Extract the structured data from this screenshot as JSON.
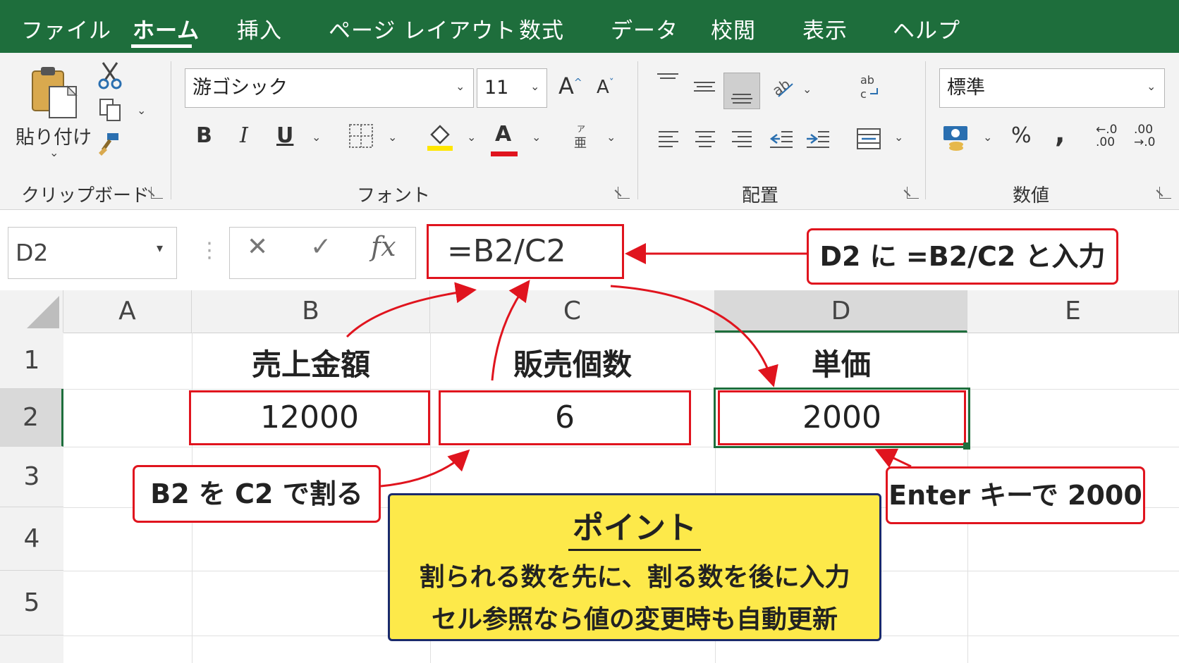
{
  "ribbon": {
    "tabs": [
      "ファイル",
      "ホーム",
      "挿入",
      "ページ レイアウト",
      "数式",
      "データ",
      "校閲",
      "表示",
      "ヘルプ"
    ],
    "active_tab": "ホーム",
    "clipboard": {
      "paste_label": "貼り付け",
      "group_label": "クリップボード"
    },
    "font": {
      "name": "游ゴシック",
      "size": "11",
      "bold": "B",
      "italic": "I",
      "underline": "U",
      "grow": "A",
      "shrink": "A",
      "font_color_glyph": "A",
      "group_label": "フォント"
    },
    "alignment": {
      "group_label": "配置"
    },
    "number": {
      "format": "標準",
      "percent": "%",
      "comma": ",",
      "inc_decimal": "←.0\n.00",
      "dec_decimal": ".00\n→.0",
      "group_label": "数値"
    }
  },
  "formula_bar": {
    "name_box": "D2",
    "cancel": "✕",
    "enter": "✓",
    "fx": "fx",
    "formula": "=B2/C2"
  },
  "grid": {
    "columns": [
      "A",
      "B",
      "C",
      "D",
      "E"
    ],
    "rows": [
      "1",
      "2",
      "3",
      "4",
      "5"
    ],
    "cells": {
      "B1": "売上金額",
      "C1": "販売個数",
      "D1": "単価",
      "B2": "12000",
      "C2": "6",
      "D2": "2000"
    },
    "selected_cell": "D2"
  },
  "annotations": {
    "formula_callout": "D2 に =B2/C2 と入力",
    "divide_callout": "B2 を C2 で割る",
    "enter_callout": "Enter キーで 2000",
    "point_title": "ポイント",
    "point_line1": "割られる数を先に、割る数を後に入力",
    "point_line2": "セル参照なら値の変更時も自動更新"
  },
  "colors": {
    "ribbon_green": "#1e6e3c",
    "highlight_red": "#e0141e",
    "point_yellow": "#fde94a",
    "point_border": "#1a2a6c"
  }
}
